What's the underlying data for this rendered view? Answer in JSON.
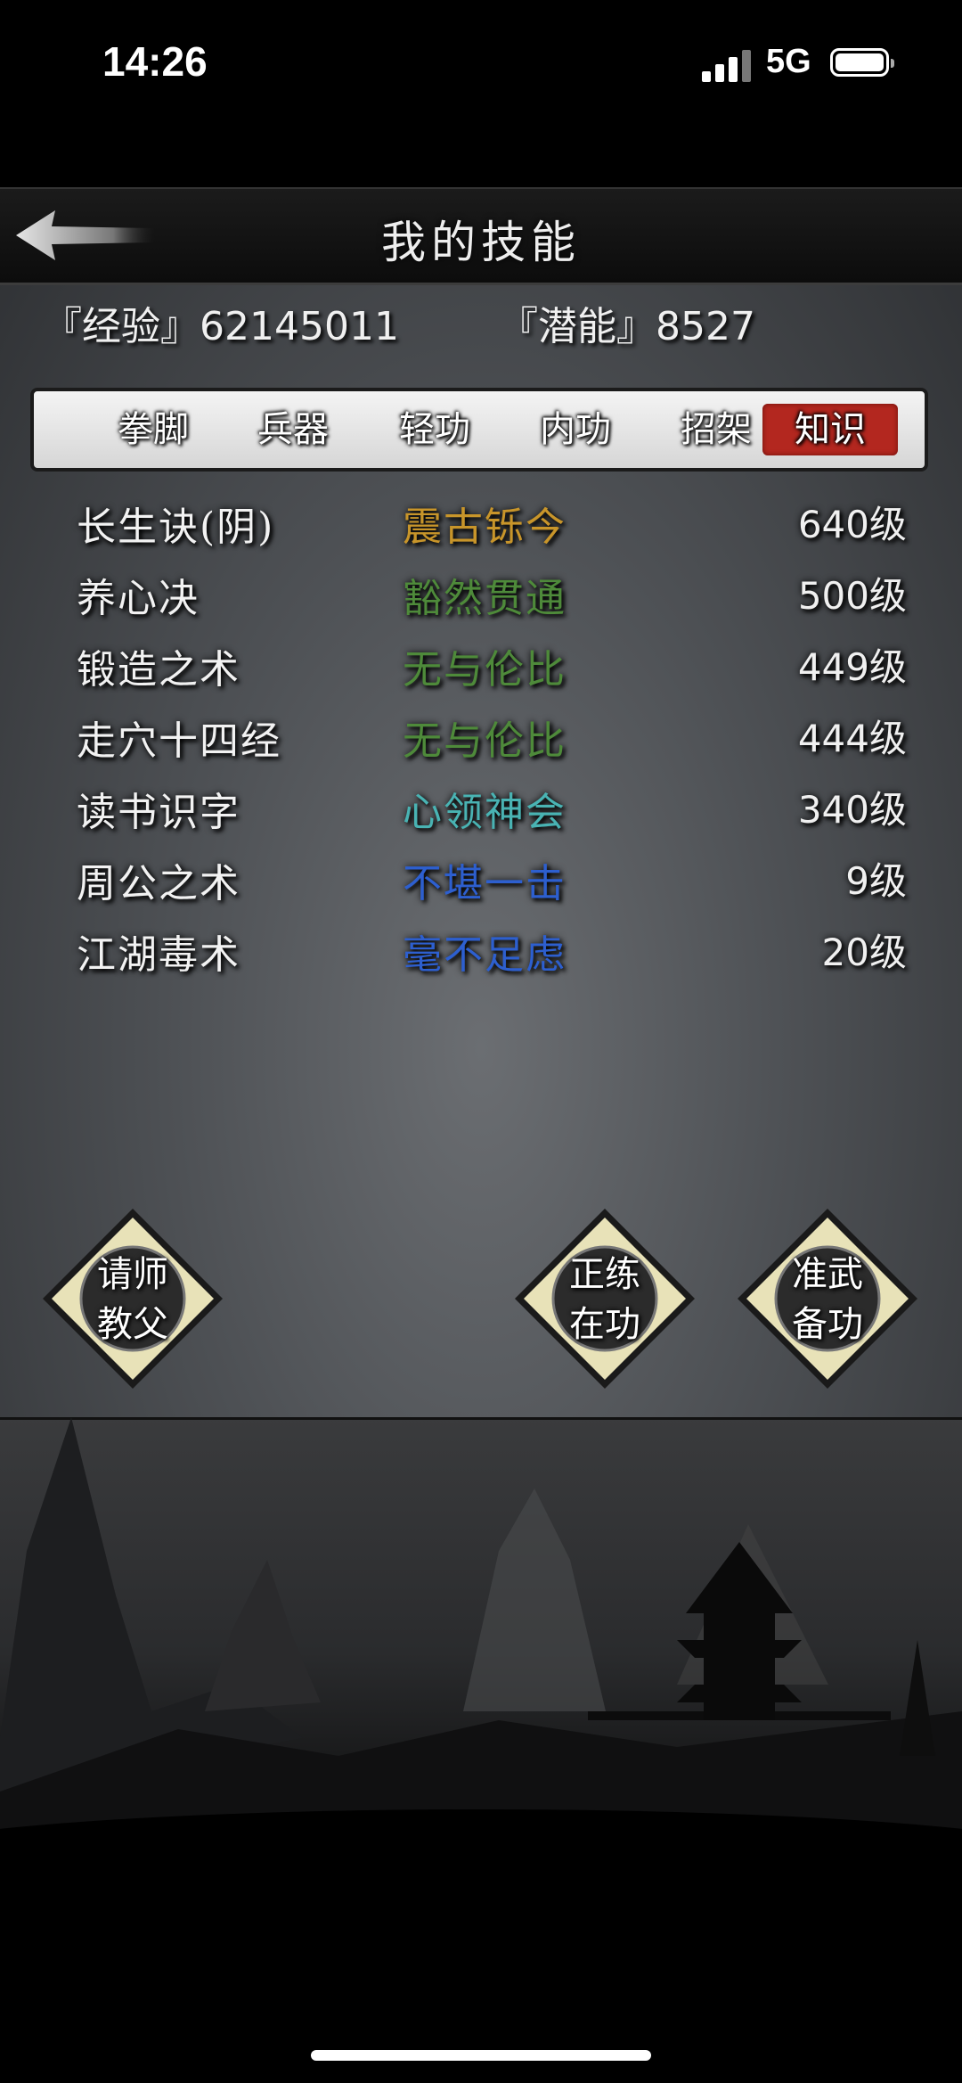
{
  "status_bar": {
    "time": "14:26",
    "network": "5G"
  },
  "header": {
    "title": "我的技能"
  },
  "resources": {
    "experience_text": "『经验』62145011",
    "potential_text": "『潜能』8527"
  },
  "tabs": [
    {
      "label": "拳脚"
    },
    {
      "label": "兵器"
    },
    {
      "label": "轻功"
    },
    {
      "label": "内功"
    },
    {
      "label": "招架"
    },
    {
      "label": "知识",
      "active": true
    }
  ],
  "skills": [
    {
      "name": "长生诀(阴)",
      "rank": "震古铄今",
      "rank_color": "#c8952a",
      "level": "640级"
    },
    {
      "name": "养心决",
      "rank": "豁然贯通",
      "rank_color": "#4e8a3a",
      "level": "500级"
    },
    {
      "name": "锻造之术",
      "rank": "无与伦比",
      "rank_color": "#4e8a3a",
      "level": "449级"
    },
    {
      "name": "走穴十四经",
      "rank": "无与伦比",
      "rank_color": "#4e8a3a",
      "level": "444级"
    },
    {
      "name": "读书识字",
      "rank": "心领神会",
      "rank_color": "#49b3b3",
      "level": "340级"
    },
    {
      "name": "周公之术",
      "rank": "不堪一击",
      "rank_color": "#2d5fcf",
      "level": "9级"
    },
    {
      "name": "江湖毒术",
      "rank": "毫不足虑",
      "rank_color": "#2d5fcf",
      "level": "20级"
    }
  ],
  "actions": {
    "seek_master": {
      "line1": "请师",
      "line2": "教父"
    },
    "practice": {
      "line1": "正练",
      "line2": "在功"
    },
    "prepare": {
      "line1": "准武",
      "line2": "备功"
    }
  },
  "colors": {
    "active_tab": "#b3271f",
    "tab_bar": "#e6e6e6"
  }
}
